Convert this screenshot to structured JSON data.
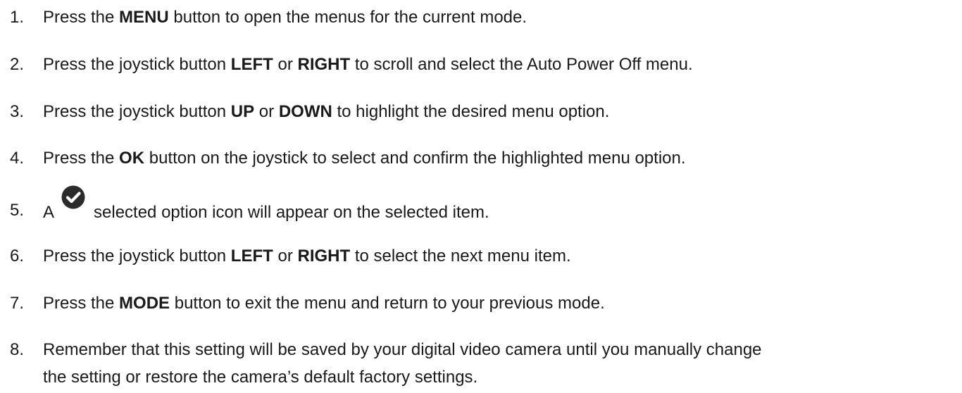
{
  "steps": [
    {
      "num": "1.",
      "t1": "Press the ",
      "b1": "MENU",
      "t2": " button to open the menus for the current mode."
    },
    {
      "num": "2.",
      "t1": "Press the joystick button ",
      "b1": "LEFT",
      "t2": " or ",
      "b2": "RIGHT",
      "t3": " to scroll and select the Auto Power Off menu."
    },
    {
      "num": "3.",
      "t1": "Press the joystick button ",
      "b1": "UP",
      "t2": " or ",
      "b2": "DOWN",
      "t3": " to highlight the desired menu option."
    },
    {
      "num": "4.",
      "t1": "Press the ",
      "b1": "OK",
      "t2": " button on the joystick to select and confirm the highlighted menu option."
    },
    {
      "num": "5.",
      "t1": "A",
      "t2": "selected option icon will appear on the selected item.",
      "icon": "check-circle-icon"
    },
    {
      "num": "6.",
      "t1": "Press the joystick button ",
      "b1": "LEFT",
      "t2": " or ",
      "b2": "RIGHT",
      "t3": " to select the next menu item."
    },
    {
      "num": "7.",
      "t1": "Press the ",
      "b1": "MODE",
      "t2": " button to exit the menu and return to your previous mode."
    },
    {
      "num": "8.",
      "line1": "Remember that this setting will be saved by your digital video camera until you manually change",
      "line2": "the setting or restore the camera’s default factory settings."
    }
  ]
}
